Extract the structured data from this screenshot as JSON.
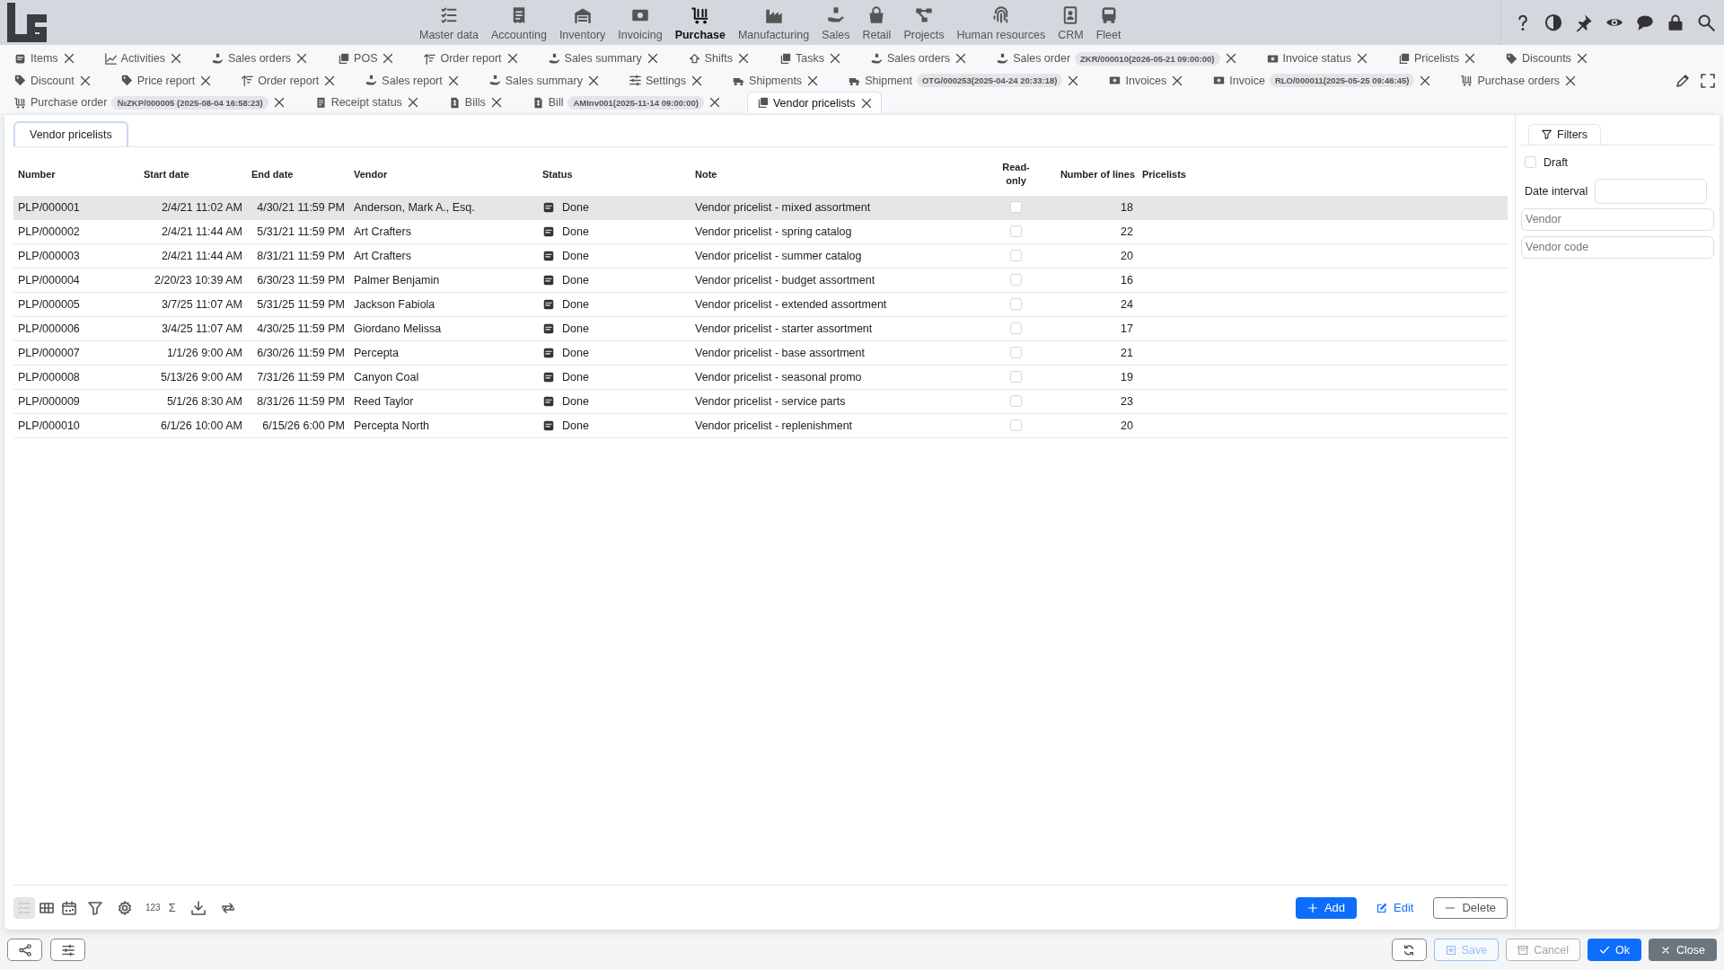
{
  "nav": {
    "items": [
      {
        "label": "Master data",
        "selected": false
      },
      {
        "label": "Accounting",
        "selected": false
      },
      {
        "label": "Inventory",
        "selected": false
      },
      {
        "label": "Invoicing",
        "selected": false
      },
      {
        "label": "Purchase",
        "selected": true
      },
      {
        "label": "Manufacturing",
        "selected": false
      },
      {
        "label": "Sales",
        "selected": false
      },
      {
        "label": "Retail",
        "selected": false
      },
      {
        "label": "Projects",
        "selected": false
      },
      {
        "label": "Human resources",
        "selected": false
      },
      {
        "label": "CRM",
        "selected": false
      },
      {
        "label": "Fleet",
        "selected": false
      }
    ]
  },
  "tab_rows": [
    [
      {
        "label": "Items",
        "selected": false
      },
      {
        "label": "Activities",
        "selected": false
      },
      {
        "label": "Sales orders",
        "selected": false
      },
      {
        "label": "POS",
        "selected": false
      },
      {
        "label": "Order report",
        "selected": false
      },
      {
        "label": "Sales summary",
        "selected": false
      },
      {
        "label": "Shifts",
        "selected": false
      },
      {
        "label": "Tasks",
        "selected": false
      },
      {
        "label": "Sales orders",
        "selected": false
      },
      {
        "label": "Sales order",
        "tag": "ZKR/000010(2026-05-21 09:00:00)",
        "selected": false
      },
      {
        "label": "Invoice status",
        "selected": false
      },
      {
        "label": "Pricelists",
        "selected": false
      },
      {
        "label": "Discounts",
        "selected": false
      }
    ],
    [
      {
        "label": "Discount",
        "selected": false
      },
      {
        "label": "Price report",
        "selected": false
      },
      {
        "label": "Order report",
        "selected": false
      },
      {
        "label": "Sales report",
        "selected": false
      },
      {
        "label": "Sales summary",
        "selected": false
      },
      {
        "label": "Settings",
        "selected": false
      },
      {
        "label": "Shipments",
        "selected": false
      },
      {
        "label": "Shipment",
        "tag": "OTG/000253(2025-04-24 20:33:18)",
        "selected": false
      },
      {
        "label": "Invoices",
        "selected": false
      },
      {
        "label": "Invoice",
        "tag": "RLO/000011(2025-05-25 09:46:45)",
        "selected": false
      },
      {
        "label": "Purchase orders",
        "selected": false
      }
    ],
    [
      {
        "label": "Purchase order",
        "tag": "№ZKP/000005 (2025-08-04 16:58:23)",
        "selected": false
      },
      {
        "label": "Receipt status",
        "selected": false
      },
      {
        "label": "Bills",
        "selected": false
      },
      {
        "label": "Bill",
        "tag": "AMInv001(2025-11-14 09:00:00)",
        "selected": false
      },
      {
        "label": "Vendor pricelists",
        "selected": true
      }
    ]
  ],
  "panel": {
    "title": "Vendor pricelists"
  },
  "table": {
    "columns": [
      "Number",
      "Start date",
      "End date",
      "Vendor",
      "Status",
      "Note",
      "Read-only",
      "Number of lines",
      "Pricelists"
    ],
    "rows": [
      {
        "number": "PLP/000001",
        "start": "2/4/21 11:02 AM",
        "end": "4/30/21 11:59 PM",
        "vendor": "Anderson, Mark A., Esq.",
        "status": "Done",
        "note": "Vendor pricelist - mixed assortment",
        "read_only": false,
        "lines": "18",
        "selected": true
      },
      {
        "number": "PLP/000002",
        "start": "2/4/21 11:44 AM",
        "end": "5/31/21 11:59 PM",
        "vendor": "Art Crafters",
        "status": "Done",
        "note": "Vendor pricelist - spring catalog",
        "read_only": false,
        "lines": "22",
        "selected": false
      },
      {
        "number": "PLP/000003",
        "start": "2/4/21 11:44 AM",
        "end": "8/31/21 11:59 PM",
        "vendor": "Art Crafters",
        "status": "Done",
        "note": "Vendor pricelist - summer catalog",
        "read_only": false,
        "lines": "20",
        "selected": false
      },
      {
        "number": "PLP/000004",
        "start": "2/20/23 10:39 AM",
        "end": "6/30/23 11:59 PM",
        "vendor": "Palmer Benjamin",
        "status": "Done",
        "note": "Vendor pricelist - budget assortment",
        "read_only": false,
        "lines": "16",
        "selected": false
      },
      {
        "number": "PLP/000005",
        "start": "3/7/25 11:07 AM",
        "end": "5/31/25 11:59 PM",
        "vendor": "Jackson Fabiola",
        "status": "Done",
        "note": "Vendor pricelist - extended assortment",
        "read_only": false,
        "lines": "24",
        "selected": false
      },
      {
        "number": "PLP/000006",
        "start": "3/4/25 11:07 AM",
        "end": "4/30/25 11:59 PM",
        "vendor": "Giordano Melissa",
        "status": "Done",
        "note": "Vendor pricelist - starter assortment",
        "read_only": false,
        "lines": "17",
        "selected": false
      },
      {
        "number": "PLP/000007",
        "start": "1/1/26 9:00 AM",
        "end": "6/30/26 11:59 PM",
        "vendor": "Percepta",
        "status": "Done",
        "note": "Vendor pricelist - base assortment",
        "read_only": false,
        "lines": "21",
        "selected": false
      },
      {
        "number": "PLP/000008",
        "start": "5/13/26 9:00 AM",
        "end": "7/31/26 11:59 PM",
        "vendor": "Canyon Coal",
        "status": "Done",
        "note": "Vendor pricelist - seasonal promo",
        "read_only": false,
        "lines": "19",
        "selected": false
      },
      {
        "number": "PLP/000009",
        "start": "5/1/26 8:30 AM",
        "end": "8/31/26 11:59 PM",
        "vendor": "Reed Taylor",
        "status": "Done",
        "note": "Vendor pricelist - service parts",
        "read_only": false,
        "lines": "23",
        "selected": false
      },
      {
        "number": "PLP/000010",
        "start": "6/1/26 10:00 AM",
        "end": "6/15/26 6:00 PM",
        "vendor": "Percepta North",
        "status": "Done",
        "note": "Vendor pricelist - replenishment",
        "read_only": false,
        "lines": "20",
        "selected": false
      }
    ]
  },
  "toolbar": {
    "views": [
      {
        "selected": true
      },
      {
        "selected": false
      },
      {
        "selected": false
      }
    ],
    "count_label": "123",
    "sum_label": "Σ"
  },
  "actions": [
    {
      "label": "Add",
      "kind": "primary"
    },
    {
      "label": "Edit",
      "kind": "link"
    },
    {
      "label": "Delete",
      "kind": "outline"
    }
  ],
  "filters": {
    "title": "Filters",
    "draft": {
      "label": "Draft",
      "checked": false
    },
    "date_interval": {
      "label": "Date interval"
    },
    "fields": [
      {
        "placeholder": "Vendor"
      },
      {
        "placeholder": "Vendor code"
      }
    ]
  },
  "footer": [
    {
      "label": "Save",
      "kind": "save",
      "disabled": true
    },
    {
      "label": "Cancel",
      "kind": "cancel",
      "disabled": true
    },
    {
      "label": "Ok",
      "kind": "ok",
      "disabled": false
    },
    {
      "label": "Close",
      "kind": "close",
      "disabled": false
    }
  ]
}
